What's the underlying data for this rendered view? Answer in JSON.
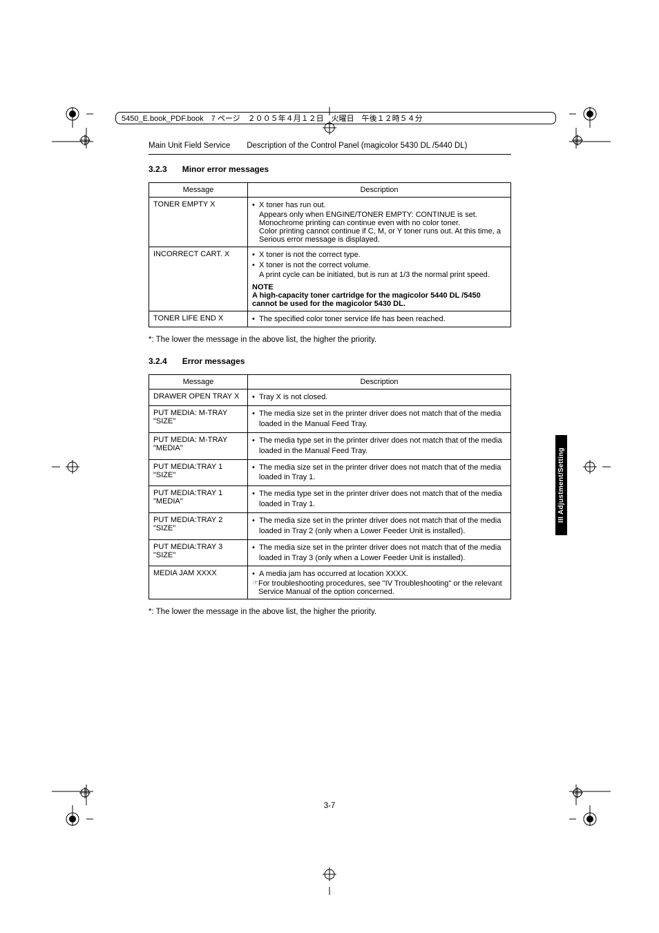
{
  "headerStrip": "5450_E.book_PDF.book　7 ページ　２００５年４月１２日　火曜日　午後１２時５４分",
  "runhead": {
    "left": "Main Unit Field Service",
    "right": "Description of the Control Panel (magicolor 5430 DL /5440 DL)"
  },
  "sec323": {
    "num": "3.2.3",
    "title": "Minor error messages"
  },
  "t1": {
    "h1": "Message",
    "h2": "Description",
    "r1": {
      "m": "TONER EMPTY X",
      "d1": "X toner has run out.",
      "d2": "Appears only when ENGINE/TONER EMPTY: CONTINUE is set.",
      "d3": "Monochrome printing can continue even with no color toner.",
      "d4": "Color printing cannot continue if C, M, or Y toner runs out. At this time, a Serious error message is displayed."
    },
    "r2": {
      "m": "INCORRECT CART. X",
      "d1": "X toner is not the correct type.",
      "d2": "X toner is not the correct volume.",
      "d3": "A print cycle can be initiated, but is run at 1/3 the normal print speed.",
      "n1": "NOTE",
      "n2": "A high-capacity toner cartridge for the magicolor 5440 DL /5450 cannot be used for the magicolor 5430 DL."
    },
    "r3": {
      "m": "TONER LIFE END X",
      "d1": "The specified color toner service life has been reached."
    }
  },
  "foot1": "*: The lower the message in the above list, the higher the priority.",
  "sec324": {
    "num": "3.2.4",
    "title": "Error messages"
  },
  "t2": {
    "h1": "Message",
    "h2": "Description",
    "r1": {
      "m": "DRAWER OPEN TRAY X",
      "d": "Tray X is not closed."
    },
    "r2": {
      "m": "PUT MEDIA: M-TRAY \"SIZE\"",
      "d": "The media size set in the printer driver does not match that of the media loaded in the Manual Feed Tray."
    },
    "r3": {
      "m": "PUT MEDIA: M-TRAY \"MEDIA\"",
      "d": "The media type set in the printer driver does not match that of the media loaded in the Manual Feed Tray."
    },
    "r4": {
      "m": "PUT MEDIA:TRAY 1 \"SIZE\"",
      "d": "The media size set in the printer driver does not match that of the media loaded in Tray 1."
    },
    "r5": {
      "m": "PUT MEDIA:TRAY 1 \"MEDIA\"",
      "d": "The media type set in the printer driver does not match that of the media loaded in Tray 1."
    },
    "r6": {
      "m": "PUT MEDIA:TRAY 2 \"SIZE\"",
      "d": "The media size set in the printer driver does not match that of the media loaded in Tray 2 (only when a Lower Feeder Unit is installed)."
    },
    "r7": {
      "m": "PUT MEDIA:TRAY 3 \"SIZE\"",
      "d": "The media size set in the printer driver does not match that of the media loaded in Tray 3 (only when a Lower Feeder Unit is installed)."
    },
    "r8": {
      "m": "MEDIA JAM XXXX",
      "d1": "A media jam has occurred at location XXXX.",
      "d2": "For troubleshooting procedures, see \"IV Troubleshooting\" or the relevant Service Manual of the option concerned."
    }
  },
  "foot2": "*: The lower the message in the above list, the higher the priority.",
  "pageNum": "3-7",
  "sideTab": "III Adjustment/Setting"
}
